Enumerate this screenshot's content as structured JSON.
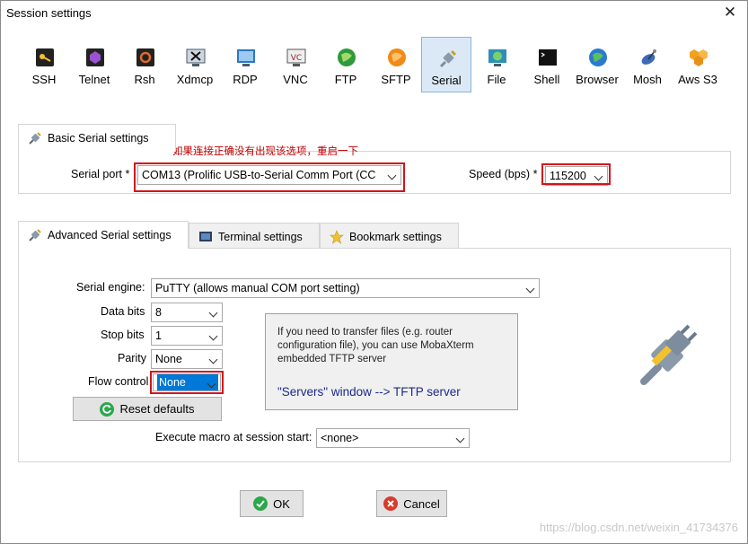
{
  "window": {
    "title": "Session settings"
  },
  "protocols": [
    {
      "label": "SSH",
      "icon": "ssh-key-icon",
      "color": "#3a3a3a"
    },
    {
      "label": "Telnet",
      "icon": "telnet-icon",
      "color": "#7a3aa8"
    },
    {
      "label": "Rsh",
      "icon": "rsh-icon",
      "color": "#b8471e"
    },
    {
      "label": "Xdmcp",
      "icon": "xdmcp-icon",
      "color": "#4a5a6a"
    },
    {
      "label": "RDP",
      "icon": "rdp-icon",
      "color": "#2b78c2"
    },
    {
      "label": "VNC",
      "icon": "vnc-icon",
      "color": "#9a2020"
    },
    {
      "label": "FTP",
      "icon": "ftp-globe-icon",
      "color": "#2e9a3a"
    },
    {
      "label": "SFTP",
      "icon": "sftp-icon",
      "color": "#f08a18"
    },
    {
      "label": "Serial",
      "icon": "serial-plug-icon",
      "color": "#6a7a8a",
      "active": true
    },
    {
      "label": "File",
      "icon": "file-monitor-icon",
      "color": "#2e8fb8"
    },
    {
      "label": "Shell",
      "icon": "shell-terminal-icon",
      "color": "#222222"
    },
    {
      "label": "Browser",
      "icon": "browser-globe-icon",
      "color": "#2a7ad0"
    },
    {
      "label": "Mosh",
      "icon": "mosh-satellite-icon",
      "color": "#3a6ab8"
    },
    {
      "label": "Aws S3",
      "icon": "aws-s3-icon",
      "color": "#f2a21c"
    }
  ],
  "basic": {
    "tab_label": "Basic Serial settings",
    "note": "如果连接正确没有出现该选项，重启一下",
    "serial_port_label": "Serial port *",
    "serial_port_value": "COM13  (Prolific USB-to-Serial Comm Port (CC",
    "speed_label": "Speed (bps) *",
    "speed_value": "115200"
  },
  "advanced_tabs": [
    {
      "label": "Advanced Serial settings",
      "icon": "plug-icon",
      "active": true
    },
    {
      "label": "Terminal settings",
      "icon": "terminal-icon"
    },
    {
      "label": "Bookmark settings",
      "icon": "star-icon"
    }
  ],
  "advanced": {
    "engine_label": "Serial engine:",
    "engine_value": "PuTTY   (allows manual COM port setting)",
    "data_bits_label": "Data bits",
    "data_bits_value": "8",
    "stop_bits_label": "Stop bits",
    "stop_bits_value": "1",
    "parity_label": "Parity",
    "parity_value": "None",
    "flow_label": "Flow control",
    "flow_value": "None",
    "reset_label": "Reset defaults",
    "macro_label": "Execute macro at session start:",
    "macro_value": "<none>",
    "info_text": "If you need to transfer files (e.g. router configuration file), you can use MobaXterm embedded TFTP server",
    "info_link": "\"Servers\" window  -->  TFTP server"
  },
  "buttons": {
    "ok": "OK",
    "cancel": "Cancel"
  },
  "watermark": "https://blog.csdn.net/weixin_41734376",
  "colors": {
    "highlight_red": "#d4141a",
    "accent_blue": "#0078d7",
    "ok_green": "#2aa84a",
    "cancel_red": "#d93a2a"
  }
}
